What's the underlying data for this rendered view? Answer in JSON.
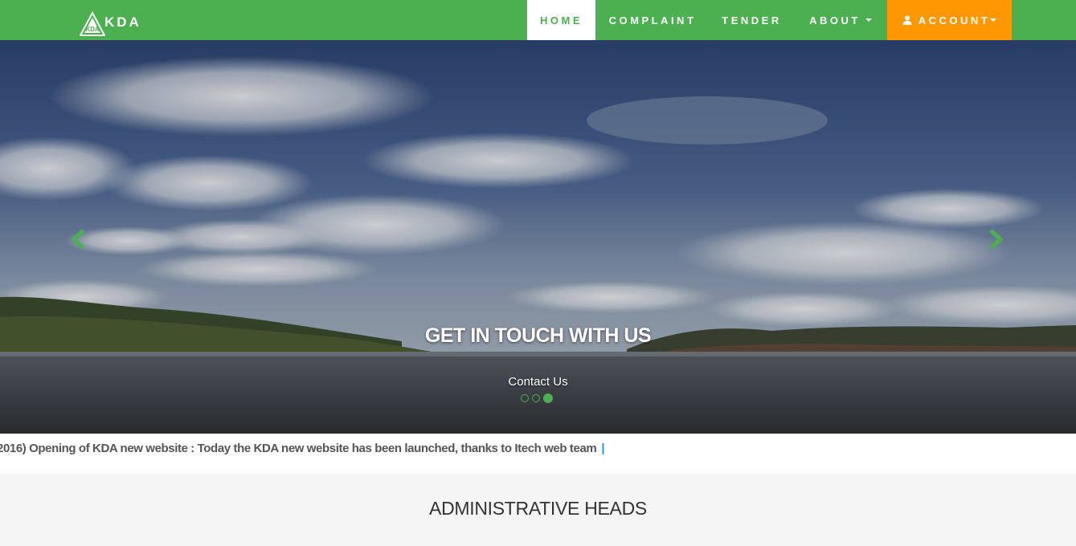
{
  "brand": {
    "name": "KDA",
    "logo_text": "KDA"
  },
  "nav": {
    "home": "HOME",
    "complaint": "COMPLAINT",
    "tender": "TENDER",
    "about": "ABOUT",
    "account": "ACCOUNT"
  },
  "hero": {
    "title": "GET IN TOUCH WITH US",
    "link": "Contact Us",
    "slides_count": 3,
    "active_slide": 3
  },
  "ticker": {
    "text": "2016) Opening of KDA new website : Today the KDA new website has been launched, thanks to Itech web team",
    "separator": "|"
  },
  "section": {
    "title": "ADMINISTRATIVE HEADS"
  },
  "icons": {
    "prev": "chevron-left-icon",
    "next": "chevron-right-icon",
    "user": "user-icon",
    "logo": "mountain-logo-icon"
  },
  "colors": {
    "nav_bg": "#4caf50",
    "accent": "#4caf50",
    "account_bg": "#ff9800",
    "ticker_separator": "#2196f3"
  }
}
